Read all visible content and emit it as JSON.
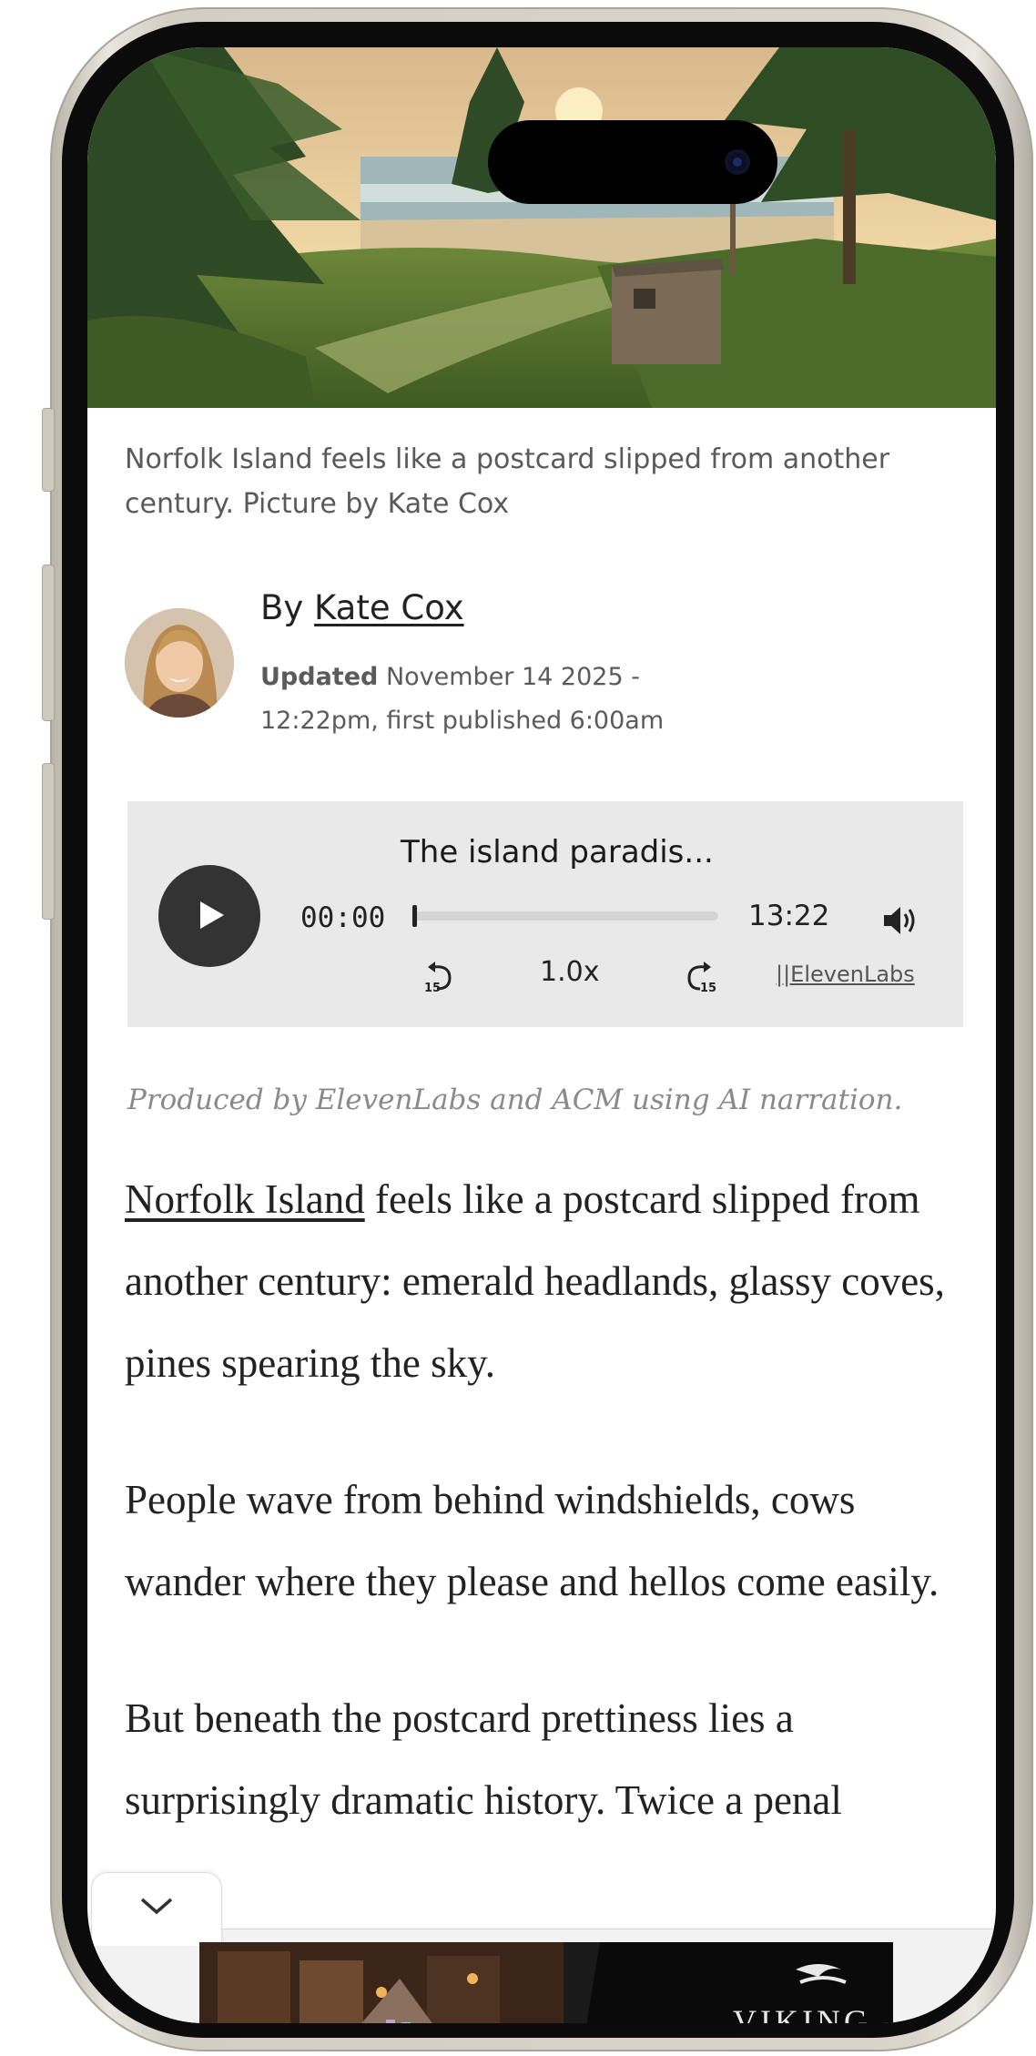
{
  "hero": {
    "caption": "Norfolk Island feels like a postcard slipped from another century. Picture by Kate Cox"
  },
  "author": {
    "by_prefix": "By",
    "name": "Kate Cox",
    "updated_label": "Updated",
    "updated_text": "November 14 2025 - 12:22pm, first published 6:00am"
  },
  "player": {
    "title": "The island paradis...",
    "current_time": "00:00",
    "total_time": "13:22",
    "progress": 0,
    "speed": "1.0x",
    "skip_seconds": "15",
    "brand": "||ElevenLabs",
    "produced_note": "Produced by ElevenLabs and ACM using AI narration."
  },
  "article": {
    "p1_link": "Norfolk Island",
    "p1_text": " feels like a postcard slipped from another century: emerald headlands, glassy coves, pines spearing the sky.",
    "p2": "People wave from behind windshields, cows wander where they please and hellos come easily.",
    "p3": "But beneath the postcard prettiness lies a surprisingly dramatic history. Twice a penal"
  },
  "ad": {
    "brand": "VIKING"
  },
  "icons": {
    "play": "play-icon",
    "volume": "volume-icon",
    "rewind": "rewind-15-icon",
    "forward": "forward-15-icon",
    "collapse": "chevron-down-icon"
  }
}
